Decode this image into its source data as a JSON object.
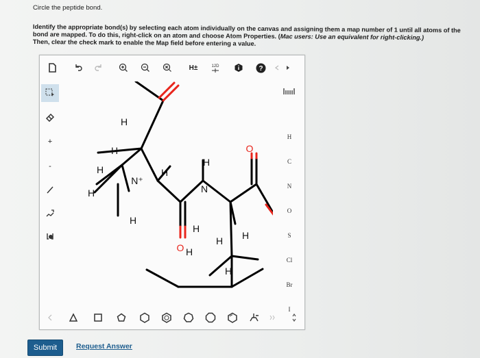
{
  "question": {
    "title": "Circle the peptide bond.",
    "instruction_main": "Identify the appropriate bond(s) by selecting each atom individually on the canvas and assigning them a map number of 1 until all atoms of the bond are mapped. To do this, right-click on an atom and choose Atom Properties. (",
    "instruction_mac": "Mac users: Use an equivalent for right-clicking.)",
    "instruction_then": "Then, clear the check mark to enable the Map field before entering a value."
  },
  "toolbar": {
    "hpm_label": "H±",
    "map_label": "12D"
  },
  "molecule": {
    "atoms": [
      "H",
      "H",
      "H",
      "H",
      "N⁺",
      "H",
      "H",
      "H",
      "N",
      "H",
      "O",
      "O",
      "O",
      "H",
      "H",
      "H",
      "H",
      "H",
      "H"
    ]
  },
  "element_palette": [
    "H",
    "C",
    "N",
    "O",
    "S",
    "Cl",
    "Br",
    "I"
  ],
  "actions": {
    "submit": "Submit",
    "request_answer": "Request Answer"
  },
  "colors": {
    "oxygen": "#e8251c",
    "bond": "#000000",
    "submit_bg": "#1d5d8e",
    "link": "#1d5d8e",
    "help_icon": "#222222"
  }
}
